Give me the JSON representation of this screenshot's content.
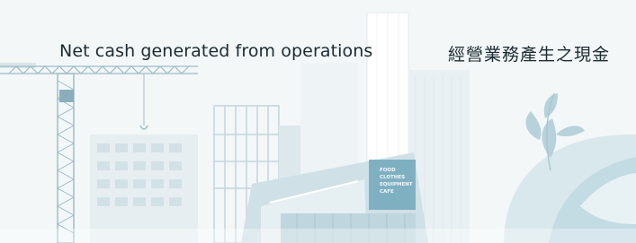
{
  "captions": {
    "english": "Net cash generated from operations",
    "chinese": "經營業務產生之現金"
  },
  "storefront_sign": [
    "FOOD",
    "CLOTHES",
    "EQUIPMENT",
    "CAFE"
  ],
  "colors": {
    "background": "#f3f7f8",
    "text": "#1c2b33",
    "building_light": "#e3ecef",
    "building_mid": "#c9dbe1",
    "accent_teal": "#6fa7bb",
    "leaf": "#b7d2db"
  },
  "icons": [
    "construction-crane-icon",
    "skyscraper-icon",
    "shopping-mall-icon",
    "leaf-icon"
  ]
}
